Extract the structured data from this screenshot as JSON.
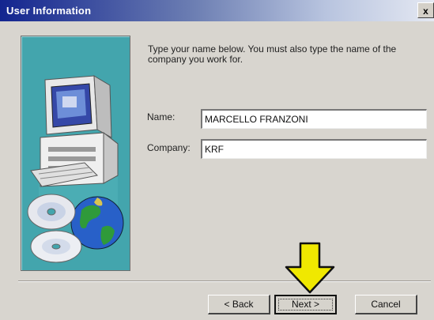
{
  "window": {
    "title": "User Information",
    "close_symbol": "x"
  },
  "instructions": "Type your name below. You must also type the name of the company you work for.",
  "form": {
    "name_label": "Name:",
    "name_value": "MARCELLO FRANZONI",
    "company_label": "Company:",
    "company_value": "KRF"
  },
  "buttons": {
    "back": "< Back",
    "next": "Next >",
    "cancel": "Cancel"
  },
  "icons": {
    "illustration": "computer-and-cds-illustration",
    "arrow": "down-arrow-icon",
    "close": "close-icon"
  },
  "colors": {
    "titlebar": "#13258f",
    "panel": "#43a5ad",
    "arrow": "#f0e800"
  }
}
